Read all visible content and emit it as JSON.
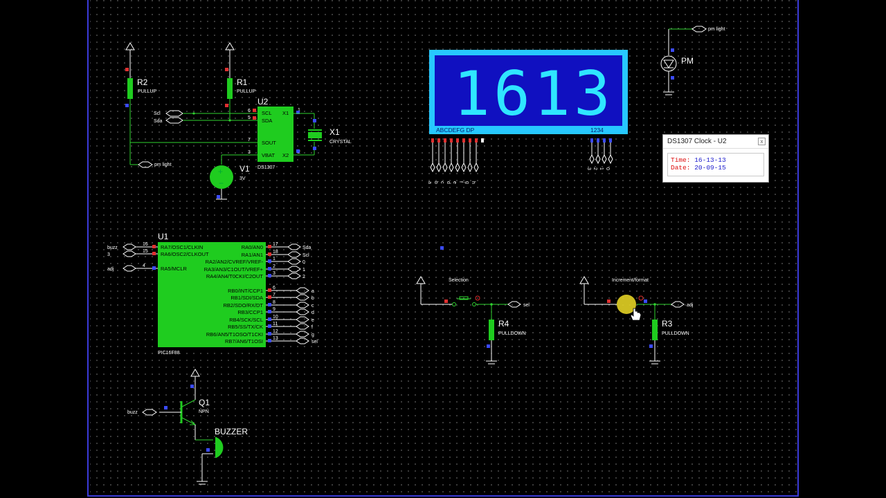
{
  "display": {
    "digits": [
      "1",
      "6",
      "1",
      "3"
    ],
    "seg_labels": "ABCDEFG  DP",
    "digit_labels": "1234"
  },
  "popup": {
    "title": "DS1307 Clock - U2",
    "close_icon": "x",
    "time_key": "Time:",
    "time_val": "16-13-13",
    "date_key": "Date:",
    "date_val": "20-09-15"
  },
  "components": {
    "r2": {
      "ref": "R2",
      "val": "PULLUP"
    },
    "r1": {
      "ref": "R1",
      "val": "PULLUP"
    },
    "u2": {
      "ref": "U2",
      "part": "DS1307",
      "pins": [
        "SCL",
        "SDA",
        "SOUT",
        "VBAT",
        "X1",
        "X2"
      ],
      "nums": [
        "6",
        "5",
        "7",
        "3",
        "1",
        "2"
      ]
    },
    "x1": {
      "ref": "X1",
      "val": "CRYSTAL"
    },
    "v1": {
      "ref": "V1",
      "val": "3V"
    },
    "pm": {
      "ref": "PM"
    },
    "u1": {
      "ref": "U1",
      "part": "PIC16F88",
      "left_pins": [
        "RA7/OSC1/CLKIN",
        "RA6/OSC2/CLKOUT",
        "RA5/MCLR"
      ],
      "left_nums": [
        "16",
        "15",
        "4"
      ],
      "right_pins_a": [
        "RA0/AN0",
        "RA1/AN1",
        "RA2/AN2/CVREF/VREF-",
        "RA3/AN3/C1OUT/VREF+",
        "RA4/AN4/T0CKI/C2OUT"
      ],
      "right_nums_a": [
        "17",
        "18",
        "1",
        "2",
        "3"
      ],
      "right_pins_b": [
        "RB0/INT/CCP1",
        "RB1/SDI/SDA",
        "RB2/SDO/RX/DT",
        "RB3/CCP1",
        "RB4/SCK/SCL",
        "RB5/SS/TX/CK",
        "RB6/AN5/T1OSO/T1CKI",
        "RB7/AN6/T1OSI"
      ],
      "right_nums_b": [
        "6",
        "7",
        "8",
        "9",
        "10",
        "11",
        "12",
        "13"
      ]
    },
    "r4": {
      "ref": "R4",
      "val": "PULLDOWN"
    },
    "r3": {
      "ref": "R3",
      "val": "PULLDOWN"
    },
    "q1": {
      "ref": "Q1",
      "val": "NPN"
    },
    "buzzer": {
      "ref": "BUZZER"
    }
  },
  "terminals": {
    "scl": "Scl",
    "sda": "Sda",
    "pm_light": "pm light",
    "pm_light2": "pm light",
    "buzz": "buzz",
    "three": "3",
    "adj": "adj",
    "ra_right": [
      "Sda",
      "Scl",
      "0",
      "1",
      "2"
    ],
    "rb_right": [
      "a",
      "b",
      "c",
      "d",
      "e",
      "f",
      "g",
      "sel"
    ],
    "seg_bottom": [
      "a",
      "b",
      "c",
      "d",
      "e",
      "f",
      "g",
      "h"
    ],
    "digit_bottom": [
      "3",
      "2",
      "1",
      "0"
    ],
    "sel": "sel",
    "adj2": "adj",
    "buzz2": "buzz"
  },
  "buttons": {
    "selection": "Selection",
    "increment": "Increment/format"
  },
  "colors": {
    "display_frame": "#27c8ff",
    "display_bg": "#1010c0",
    "digit": "#2fe6ff",
    "component": "#1fcc1f",
    "wire": "#31d431"
  }
}
